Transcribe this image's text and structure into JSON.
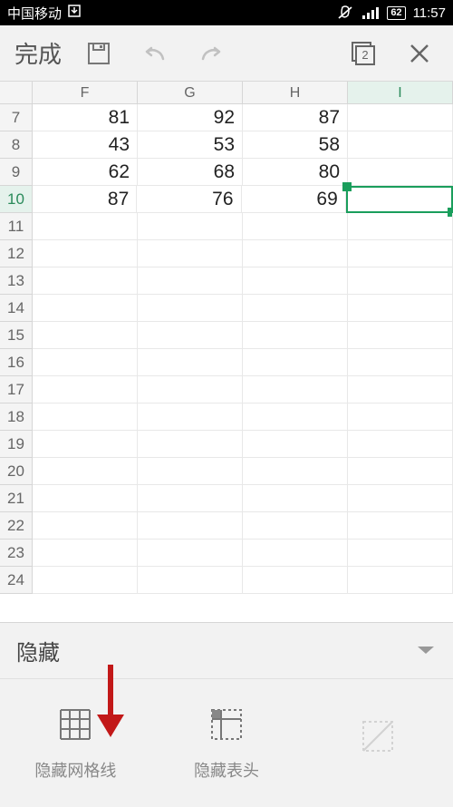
{
  "status": {
    "carrier": "中国移动",
    "battery_text": "62",
    "time": "11:57"
  },
  "toolbar": {
    "done_label": "完成",
    "sheet_badge": "2"
  },
  "columns": [
    "F",
    "G",
    "H",
    "I"
  ],
  "rows": [
    {
      "n": "7",
      "cells": [
        "81",
        "92",
        "87",
        ""
      ]
    },
    {
      "n": "8",
      "cells": [
        "43",
        "53",
        "58",
        ""
      ]
    },
    {
      "n": "9",
      "cells": [
        "62",
        "68",
        "80",
        ""
      ]
    },
    {
      "n": "10",
      "cells": [
        "87",
        "76",
        "69",
        ""
      ]
    },
    {
      "n": "11",
      "cells": [
        "",
        "",
        "",
        ""
      ]
    },
    {
      "n": "12",
      "cells": [
        "",
        "",
        "",
        ""
      ]
    },
    {
      "n": "13",
      "cells": [
        "",
        "",
        "",
        ""
      ]
    },
    {
      "n": "14",
      "cells": [
        "",
        "",
        "",
        ""
      ]
    },
    {
      "n": "15",
      "cells": [
        "",
        "",
        "",
        ""
      ]
    },
    {
      "n": "16",
      "cells": [
        "",
        "",
        "",
        ""
      ]
    },
    {
      "n": "17",
      "cells": [
        "",
        "",
        "",
        ""
      ]
    },
    {
      "n": "18",
      "cells": [
        "",
        "",
        "",
        ""
      ]
    },
    {
      "n": "19",
      "cells": [
        "",
        "",
        "",
        ""
      ]
    },
    {
      "n": "20",
      "cells": [
        "",
        "",
        "",
        ""
      ]
    },
    {
      "n": "21",
      "cells": [
        "",
        "",
        "",
        ""
      ]
    },
    {
      "n": "22",
      "cells": [
        "",
        "",
        "",
        ""
      ]
    },
    {
      "n": "23",
      "cells": [
        "",
        "",
        "",
        ""
      ]
    },
    {
      "n": "24",
      "cells": [
        "",
        "",
        "",
        ""
      ]
    }
  ],
  "selected": {
    "row": "10",
    "col": "I"
  },
  "panel": {
    "title": "隐藏",
    "items": [
      {
        "label": "隐藏网格线",
        "icon": "grid"
      },
      {
        "label": "隐藏表头",
        "icon": "headers"
      },
      {
        "label": "",
        "icon": "disabled"
      }
    ]
  }
}
